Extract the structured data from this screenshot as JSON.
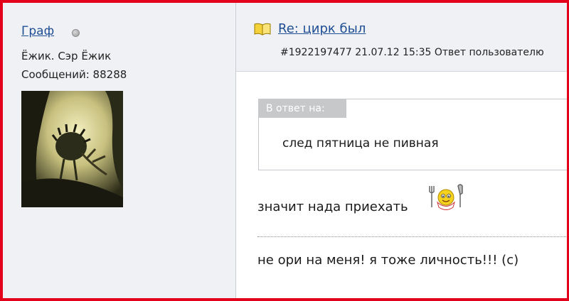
{
  "author": {
    "name": "Граф",
    "title": "Ёжик. Сэр Ёжик",
    "posts": "Сообщений: 88288",
    "status_icon": "offline-dot-icon"
  },
  "post": {
    "title": "Re: цирк был",
    "meta": "#1922197477 21.07.12 15:35  Ответ пользователю",
    "icon": "book-icon"
  },
  "quote": {
    "label": "В ответ на:",
    "text": "след пятница не пивная"
  },
  "body": {
    "line1": "значит нада приехать",
    "smiley": "hungry-smiley-icon",
    "signature": "не ори на меня! я тоже личность!!! (с)"
  },
  "colors": {
    "frame": "#e3001b",
    "link": "#1e4e93",
    "panel": "#f0f1f4",
    "quote_label_bg": "#c7c8ca"
  }
}
